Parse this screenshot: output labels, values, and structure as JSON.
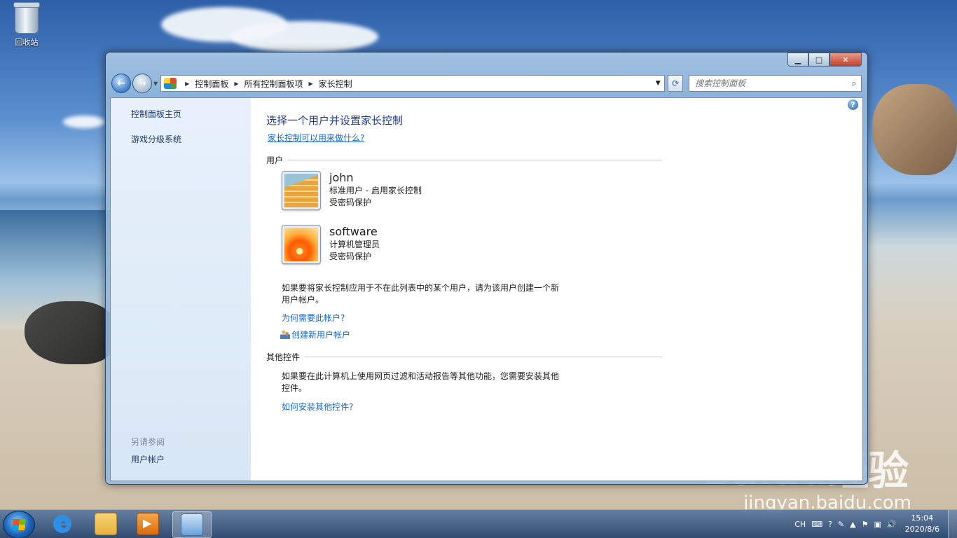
{
  "desktop": {
    "recycle_bin_label": "回收站",
    "watermark_logo": "Baidu经验",
    "watermark_url": "jingyan.baidu.com"
  },
  "window": {
    "caption": {
      "minimize": "▁",
      "maximize": "□",
      "close": "✕"
    },
    "nav": {
      "back": "←",
      "forward": "→",
      "history": "▼"
    },
    "breadcrumb": [
      "控制面板",
      "所有控制面板项",
      "家长控制"
    ],
    "address_dropdown": "▼",
    "refresh": "⟳",
    "search_placeholder": "搜索控制面板",
    "search_icon": "⌕"
  },
  "sidebar": {
    "home_link": "控制面板主页",
    "game_ratings_link": "游戏分级系统",
    "see_also_heading": "另请参阅",
    "user_accounts_link": "用户帐户"
  },
  "main": {
    "help_icon": "?",
    "title": "选择一个用户并设置家长控制",
    "what_can_do_link": "家长控制可以用来做什么?",
    "users_section_label": "用户",
    "users": [
      {
        "name": "john",
        "type": "标准用户 - 启用家长控制",
        "protection": "受密码保护",
        "avatar_icon": "stairs-avatar"
      },
      {
        "name": "software",
        "type": "计算机管理员",
        "protection": "受密码保护",
        "avatar_icon": "flower-avatar"
      }
    ],
    "create_account_text": "如果要将家长控制应用于不在此列表中的某个用户，请为该用户创建一个新用户帐户。",
    "why_need_account_link": "为何需要此帐户?",
    "create_new_account_link": "创建新用户帐户",
    "other_controls_label": "其他控件",
    "other_controls_text": "如果要在此计算机上使用网页过滤和活动报告等其他功能，您需要安装其他控件。",
    "how_install_link": "如何安装其他控件?"
  },
  "taskbar": {
    "tray_lang": "CH",
    "tray_keyboard": "⌨",
    "tray_help": "?",
    "tray_pen": "✎",
    "tray_arrow": "▲",
    "tray_flag": "⚑",
    "tray_network": "▣",
    "tray_volume": "🔊",
    "time": "15:04",
    "date": "2020/8/6"
  },
  "colors": {
    "link": "#1a66c9",
    "title": "#1e3a8a",
    "sidebar_bg": "#e4eefa"
  }
}
